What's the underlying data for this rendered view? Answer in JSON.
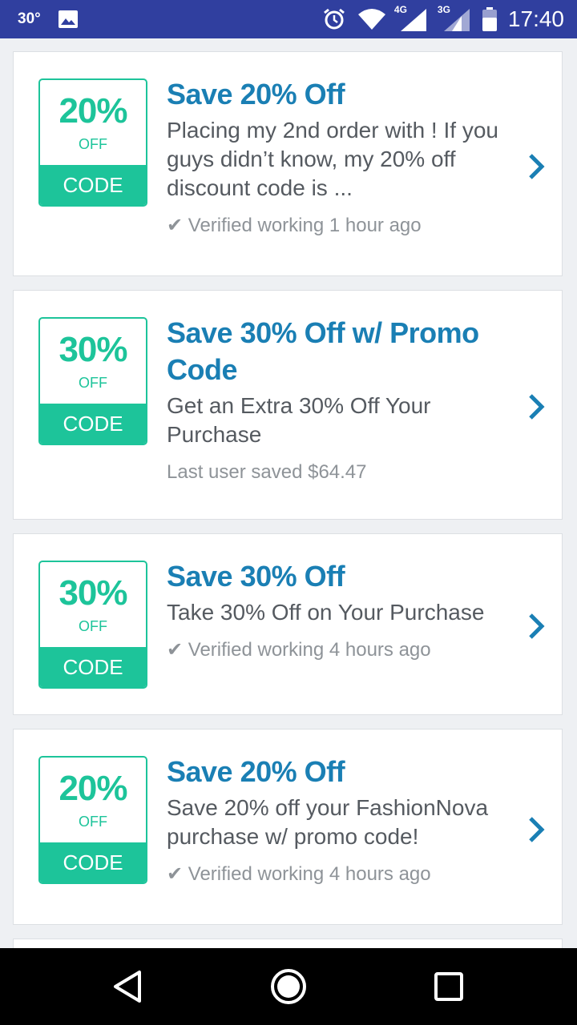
{
  "status_bar": {
    "temperature": "30°",
    "network_4g": "4G",
    "network_3g": "3G",
    "time": "17:40",
    "icons": [
      "image-icon",
      "alarm-icon",
      "wifi-icon",
      "signal-icon",
      "battery-icon"
    ]
  },
  "deals": [
    {
      "badge_percent": "20%",
      "badge_off": "OFF",
      "badge_code": "CODE",
      "title": "Save 20% Off",
      "description": "Placing my 2nd order with ! If you guys didn’t know, my 20% off discount code is ...",
      "meta": "✔ Verified working 1 hour ago"
    },
    {
      "badge_percent": "30%",
      "badge_off": "OFF",
      "badge_code": "CODE",
      "title": "Save 30% Off w/ Promo Code",
      "description": "Get an Extra 30% Off Your Purchase",
      "meta": "Last user saved $64.47"
    },
    {
      "badge_percent": "30%",
      "badge_off": "OFF",
      "badge_code": "CODE",
      "title": "Save 30% Off",
      "description": "Take 30% Off on Your Purchase",
      "meta": "✔ Verified working 4 hours ago"
    },
    {
      "badge_percent": "20%",
      "badge_off": "OFF",
      "badge_code": "CODE",
      "title": "Save 20% Off",
      "description": "Save 20% off your FashionNova purchase w/ promo code!",
      "meta": "✔ Verified working 4 hours ago"
    }
  ],
  "colors": {
    "status_bar": "#303f9f",
    "accent_green": "#1dc49a",
    "title_blue": "#1a7fb4"
  }
}
